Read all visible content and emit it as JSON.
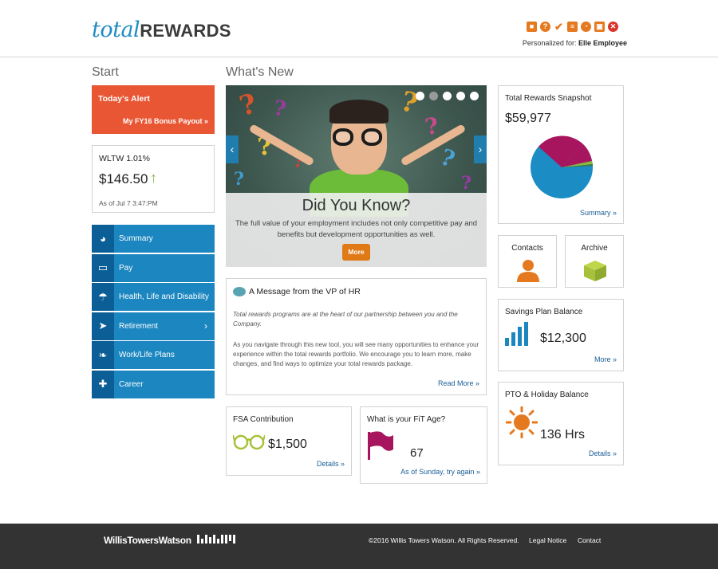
{
  "header": {
    "logo_total": "total",
    "logo_rewards": "REWARDS",
    "personalized_label": "Personalized for:",
    "personalized_name": "Elle Employee",
    "icons": [
      "cube-icon",
      "help-icon",
      "check-icon",
      "document-icon",
      "pie-icon",
      "lock-icon",
      "close-icon"
    ]
  },
  "start": {
    "title": "Start",
    "alert": {
      "title": "Today's Alert",
      "link": "My FY16 Bonus Payout »"
    },
    "stock": {
      "name": "WLTW 1.01%",
      "price": "$146.50",
      "as_of": "As of Jul 7 3:47:PM"
    },
    "nav": [
      {
        "label": "Summary",
        "icon": "pie-chart-icon",
        "has_chevron": false
      },
      {
        "label": "Pay",
        "icon": "wallet-icon",
        "has_chevron": false
      },
      {
        "label": "Health, Life and Disability",
        "icon": "umbrella-icon",
        "has_chevron": false
      },
      {
        "label": "Retirement",
        "icon": "plane-icon",
        "has_chevron": true
      },
      {
        "label": "Work/Life Plans",
        "icon": "leaf-icon",
        "has_chevron": false
      },
      {
        "label": "Career",
        "icon": "puzzle-icon",
        "has_chevron": false
      }
    ]
  },
  "whats_new": {
    "title": "What's New",
    "hero": {
      "title": "Did You Know?",
      "body": "The full value of your employment includes not only competitive pay and benefits but development opportunities as well.",
      "button": "More",
      "slides": 5,
      "active_slide": 1
    },
    "message": {
      "title": "A Message from the VP of HR",
      "p1": "Total rewards programs are at the heart of our partnership between you and the Company.",
      "p2": "As you navigate through this new tool, you will see many opportunities to enhance your experience within the total rewards portfolio. We encourage you to learn more, make changes, and find ways to optimize your total rewards package.",
      "link": "Read More »"
    },
    "fsa": {
      "title": "FSA Contribution",
      "value": "$1,500",
      "link": "Details »"
    },
    "fit": {
      "title": "What is your FiT Age?",
      "value": "67",
      "link": "As of Sunday, try again »"
    }
  },
  "right": {
    "snapshot": {
      "title": "Total Rewards Snapshot",
      "value": "$59,977",
      "link": "Summary »",
      "pie_colors": [
        "#1b8cc4",
        "#a8155f",
        "#8fb83f",
        "#3d7a3a"
      ]
    },
    "contacts": {
      "title": "Contacts"
    },
    "archive": {
      "title": "Archive"
    },
    "savings": {
      "title": "Savings Plan Balance",
      "value": "$12,300",
      "link": "More »"
    },
    "pto": {
      "title": "PTO & Holiday Balance",
      "value": "136 Hrs",
      "link": "Details »"
    }
  },
  "footer": {
    "brand": "WillisTowersWatson",
    "copyright": "©2016 Willis Towers Watson. All Rights Reserved.",
    "legal": "Legal Notice",
    "contact": "Contact"
  },
  "colors": {
    "accent_blue": "#1b86c0",
    "alert_orange": "#e85633",
    "icon_orange": "#e5791f",
    "footer_bg": "#333333"
  }
}
